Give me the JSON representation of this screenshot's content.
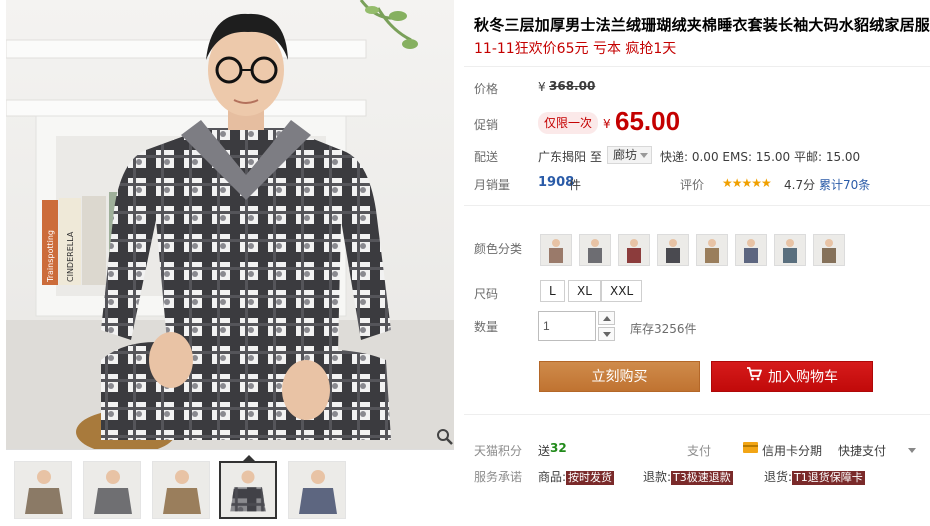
{
  "product": {
    "title": "秋冬三层加厚男士法兰绒珊瑚绒夹棉睡衣套装长袖大码水貂绒家居服",
    "subtitle": "11-11狂欢价65元 亏本 疯抢1天"
  },
  "gallery": {
    "main_image": "man-in-plaid-pajamas-photo",
    "zoom_icon": "magnifier-icon",
    "thumbnail_count": 5,
    "active_thumbnail": 4,
    "book_spines": [
      "Trainspotting",
      "CINDERELLA"
    ]
  },
  "price": {
    "label": "价格",
    "currency_symbol": "¥",
    "original": "368.00"
  },
  "promotion": {
    "label": "促销",
    "badge": "仅限一次",
    "currency_symbol": "¥",
    "price": "65.00"
  },
  "shipping": {
    "label": "配送",
    "from": "广东揭阳",
    "to_word": "至",
    "city": "廊坊",
    "fees": "快递: 0.00 EMS: 15.00 平邮: 15.00"
  },
  "sales": {
    "label": "月销量",
    "count": "1908",
    "unit": "件",
    "rating_label": "评价",
    "stars": "★★★★★",
    "rating": 4.7,
    "rating_text": "4.7分",
    "total_reviews": "累计70条"
  },
  "color": {
    "label": "颜色分类",
    "swatch_count": 8
  },
  "size": {
    "label": "尺码",
    "options": [
      "L",
      "XL",
      "XXL"
    ]
  },
  "quantity": {
    "label": "数量",
    "value": "1",
    "stock": "库存3256件"
  },
  "actions": {
    "buy_now": "立刻购买",
    "add_to_cart": "加入购物车"
  },
  "points": {
    "label": "天猫积分",
    "prefix": "送",
    "value": "32"
  },
  "payment": {
    "label": "支付",
    "credit": "信用卡分期",
    "quick": "快捷支付"
  },
  "service": {
    "label": "服务承诺",
    "goods_label": "商品:",
    "goods_tag": "按时发货",
    "refund_label": "退款:",
    "refund_tag": "T3极速退款",
    "return_label": "退货:",
    "return_tag": "T1退货保障卡"
  },
  "colors": {
    "promo_red": "#c40000",
    "buy_now_orange": "#c8803e",
    "cart_red": "#cc1010",
    "link_blue": "#2a5ba8",
    "points_green": "#218a1a",
    "star_gold": "#f0a000"
  }
}
